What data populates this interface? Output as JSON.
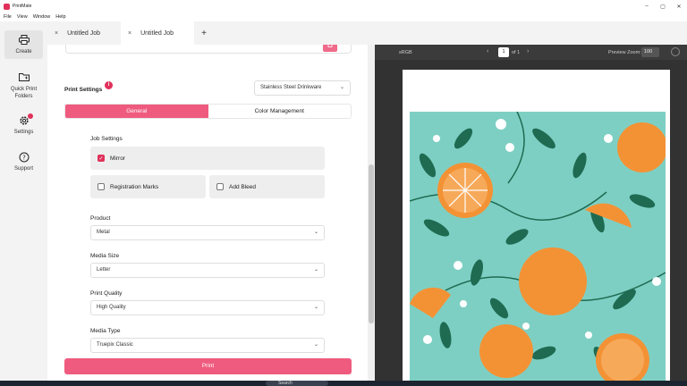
{
  "window": {
    "title": "PrintMate",
    "controls": [
      "–",
      "▢",
      "✕"
    ]
  },
  "menu": [
    "File",
    "View",
    "Window",
    "Help"
  ],
  "tabs": [
    {
      "label": "Untitled Job",
      "close": "×"
    },
    {
      "label": "Untitled Job",
      "close": "×"
    }
  ],
  "tab_add": "+",
  "sidebar": {
    "items": [
      {
        "label": "Create",
        "icon": "printer-icon"
      },
      {
        "label": "Quick Print Folders",
        "icon": "folder-icon"
      },
      {
        "label": "Settings",
        "icon": "gear-icon"
      },
      {
        "label": "Support",
        "icon": "help-icon"
      }
    ],
    "help_glyph": "?"
  },
  "settings": {
    "print_settings_label": "Print Settings",
    "info_glyph": "i",
    "printer_value": "Stainless Steel Drinkware",
    "tabs": {
      "general": "General",
      "color": "Color Management"
    },
    "job_settings_label": "Job Settings",
    "mirror": {
      "label": "Mirror",
      "checked": true
    },
    "registration_marks": {
      "label": "Registration Marks",
      "checked": false
    },
    "add_bleed": {
      "label": "Add Bleed",
      "checked": false
    },
    "product": {
      "label": "Product",
      "value": "Metal"
    },
    "media_size": {
      "label": "Media Size",
      "value": "Letter"
    },
    "print_quality": {
      "label": "Print Quality",
      "value": "High Quality"
    },
    "media_type": {
      "label": "Media Type",
      "value": "Truepix Classic"
    },
    "print_button": "Print"
  },
  "preview": {
    "color_space": "sRGB",
    "page": "1",
    "of_label": "of 1",
    "zoom_label": "Preview Zoom:",
    "zoom_value": "100"
  },
  "taskbar": {
    "search_placeholder": "Search"
  },
  "colors": {
    "accent": "#e0315a",
    "accent_light": "#ef5b7e",
    "artwork_bg": "#7ecfc3",
    "orange": "#f39235",
    "leaf": "#1e6b52"
  }
}
